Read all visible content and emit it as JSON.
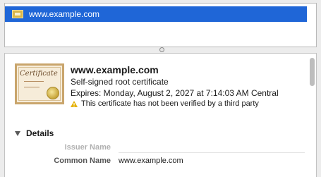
{
  "trust_list": {
    "selected_item": {
      "label": "www.example.com",
      "icon": "certificate-icon"
    },
    "colors": {
      "selection": "#1f66d7"
    }
  },
  "certificate": {
    "domain": "www.example.com",
    "type": "Self-signed root certificate",
    "expires": "Expires: Monday, August 2, 2027 at 7:14:03 AM Central",
    "warning": "This certificate has not been verified by a third party",
    "image_text": "Certificate"
  },
  "details": {
    "heading": "Details",
    "expanded": true,
    "sections": [
      {
        "label": "Issuer Name"
      }
    ],
    "fields": [
      {
        "label": "Common Name",
        "value": "www.example.com"
      }
    ]
  }
}
